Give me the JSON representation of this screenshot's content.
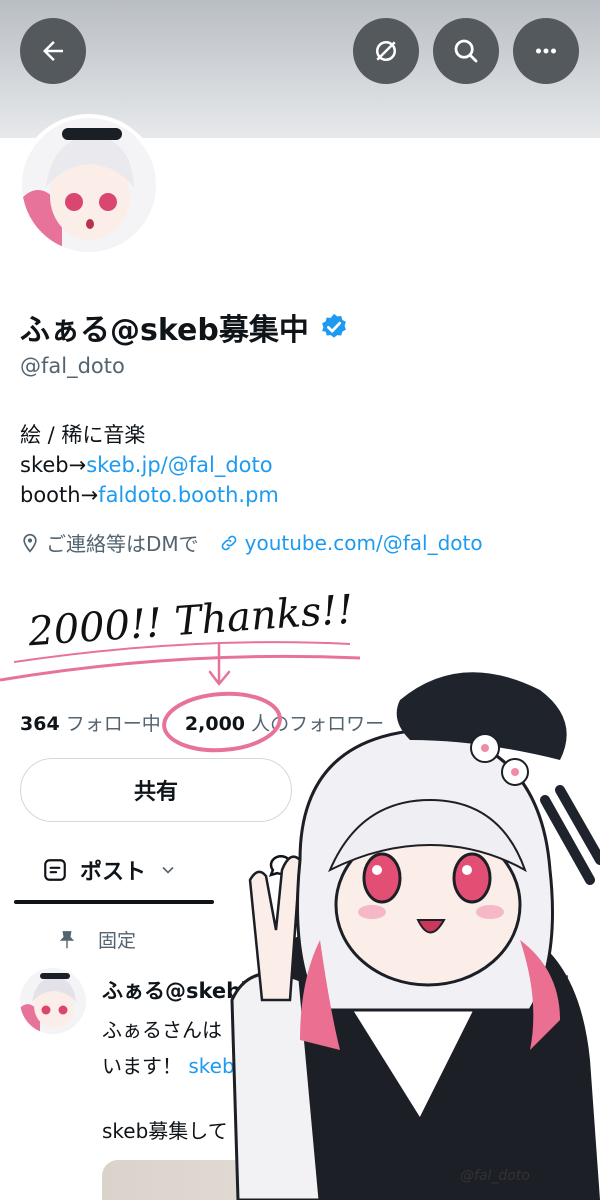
{
  "header": {
    "back_icon": "arrow-left-icon",
    "action_icons": [
      "grok-slash-icon",
      "search-icon",
      "more-icon"
    ],
    "button_color": "#54595e"
  },
  "profile": {
    "display_name": "ふぁる@skeb募集中",
    "verified": true,
    "handle": "@fal_doto",
    "bio_line1": "絵 / 稀に音楽",
    "bio_line2_prefix": "skeb→",
    "bio_line2_link": "skeb.jp/@fal_doto",
    "bio_line3_prefix": "booth→",
    "bio_line3_link": "faldoto.booth.pm",
    "location": "ご連絡等はDMで",
    "website": "youtube.com/@fal_doto"
  },
  "stats": {
    "following_count": "364",
    "following_label": "フォロー中",
    "followers_count": "2,000",
    "followers_label": "人のフォロワー"
  },
  "actions": {
    "share_label": "共有"
  },
  "tabs": {
    "posts_label": "ポスト"
  },
  "pinned": {
    "label": "固定",
    "author": "ふぁる@skeb募集中",
    "text_part1": "ふぁるさんは",
    "text_part2": "います！",
    "link": "skeb.jp",
    "line2": "skeb募集して"
  },
  "artwork": {
    "handwritten_text": "2000!! Thanks!!",
    "signature": "@fal_doto"
  },
  "colors": {
    "accent": "#1d9bf0",
    "annotation_pink": "#e8739a",
    "text": "#0f1419",
    "muted": "#536471"
  }
}
